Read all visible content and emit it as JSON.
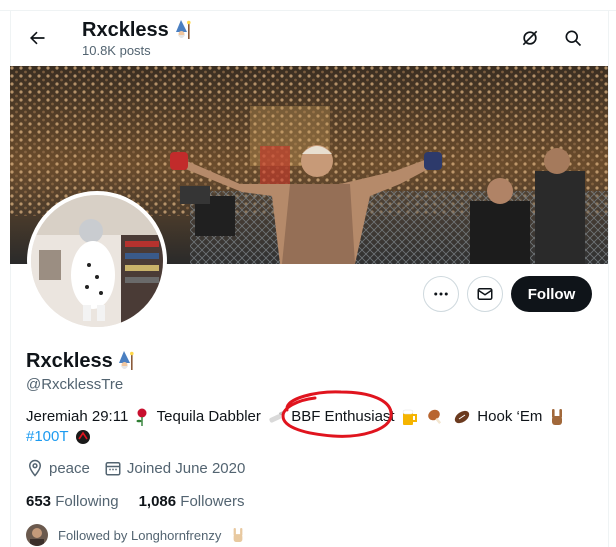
{
  "header": {
    "title": "Rxckless",
    "posts_count": "10.8K posts"
  },
  "profile": {
    "display_name": "Rxckless",
    "handle": "@RxcklessTre",
    "bio": {
      "part1": "Jeremiah 29:11",
      "part2": "Tequila Dabbler",
      "part3": "BBF Enthusiast",
      "part4": "Hook ‘Em",
      "hashtag": "#100T"
    },
    "location": "peace",
    "joined": "Joined June 2020",
    "following_count": "653",
    "following_label": "Following",
    "followers_count": "1,086",
    "followers_label": "Followers",
    "followed_by": "Followed by Longhornfrenzy"
  },
  "actions": {
    "follow_label": "Follow"
  },
  "colors": {
    "accent": "#1d9bf0",
    "follow_bg": "#0f1419",
    "highlight": "#e0141e"
  },
  "icons": [
    "back-arrow-icon",
    "grok-icon",
    "search-icon",
    "more-icon",
    "mail-icon",
    "location-icon",
    "calendar-icon"
  ]
}
